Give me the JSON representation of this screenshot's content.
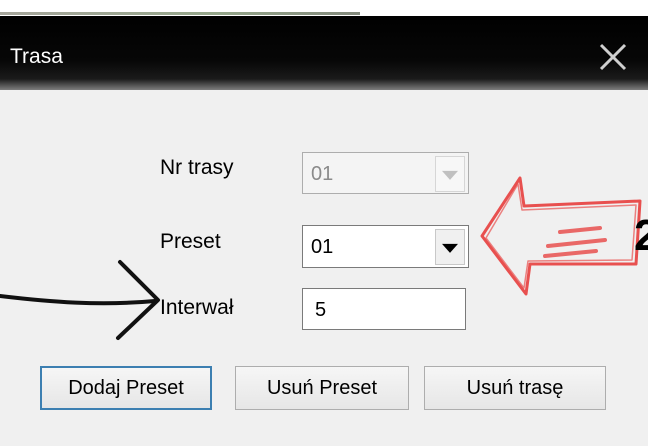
{
  "window": {
    "title": "Trasa",
    "close_glyph": "✕"
  },
  "form": {
    "route_label": "Nr trasy",
    "route_value": "01",
    "preset_label": "Preset",
    "preset_value": "01",
    "interval_label": "Interwał",
    "interval_value": "5"
  },
  "buttons": {
    "add_preset": "Dodaj Preset",
    "remove_preset": "Usuń Preset",
    "remove_route": "Usuń trasę"
  },
  "annotation": {
    "number_fragment": "2",
    "red_arrow_color": "#e8504f",
    "black_arrow_color": "#111111"
  }
}
